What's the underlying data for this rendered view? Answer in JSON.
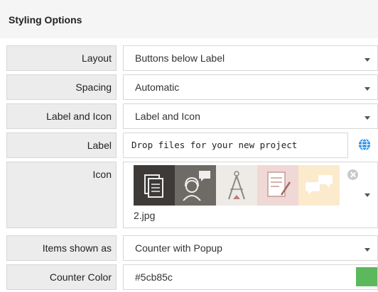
{
  "panel": {
    "title": "Styling Options"
  },
  "rows": {
    "layout": {
      "label": "Layout",
      "value": "Buttons below Label"
    },
    "spacing": {
      "label": "Spacing",
      "value": "Automatic"
    },
    "label_and_icon": {
      "label": "Label and Icon",
      "value": "Label and Icon"
    },
    "label": {
      "label": "Label",
      "value": "Drop files for your new project"
    },
    "icon": {
      "label": "Icon",
      "filename": "2.jpg",
      "tiles": [
        "files-icon",
        "support-agent-icon",
        "architect-compass-icon",
        "document-sign-icon",
        "chat-bubbles-icon"
      ]
    },
    "items_shown_as": {
      "label": "Items shown as",
      "value": "Counter with Popup"
    },
    "counter_color": {
      "label": "Counter Color",
      "value": "#5cb85c",
      "swatch_color": "#5cb85c"
    }
  }
}
